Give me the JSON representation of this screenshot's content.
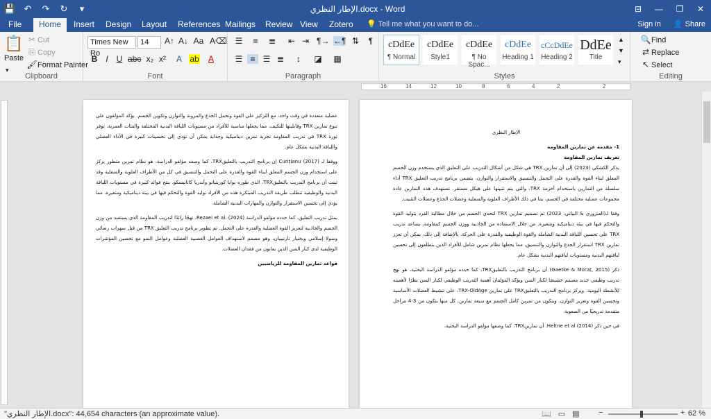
{
  "title": "الإطار النظري.docx - Word",
  "quick_access": {
    "save": "💾",
    "undo": "↶",
    "redo": "↷",
    "refresh": "↻",
    "customize": "▾"
  },
  "window_controls": {
    "ribbon_options": "⊟",
    "minimize": "—",
    "restore": "❐",
    "close": "✕"
  },
  "tabs": [
    "File",
    "Home",
    "Insert",
    "Design",
    "Layout",
    "References",
    "Mailings",
    "Review",
    "View",
    "Zotero"
  ],
  "tell_me": "Tell me what you want to do...",
  "sign_in": "Sign in",
  "share": "Share",
  "clipboard": {
    "label": "Clipboard",
    "paste": "Paste",
    "cut": "Cut",
    "copy": "Copy",
    "format_painter": "Format Painter"
  },
  "font": {
    "label": "Font",
    "family": "Times New Ro",
    "size": "14"
  },
  "paragraph": {
    "label": "Paragraph"
  },
  "styles": {
    "label": "Styles",
    "items": [
      {
        "sample": "cDdEe",
        "name": "¶ Normal"
      },
      {
        "sample": "cDdEe",
        "name": "Style1"
      },
      {
        "sample": "cDdEe",
        "name": "¶ No Spac..."
      },
      {
        "sample": "cDdEe",
        "name": "Heading 1"
      },
      {
        "sample": "cCcDdEe",
        "name": "Heading 2"
      },
      {
        "sample": "DdEe",
        "name": "Title"
      }
    ]
  },
  "editing": {
    "label": "Editing",
    "find": "Find",
    "replace": "Replace",
    "select": "Select"
  },
  "ruler_numbers": [
    "16",
    "14",
    "12",
    "10",
    "8",
    "6",
    "4",
    "2",
    "2"
  ],
  "right_page": {
    "title": "الإطار النظري",
    "heading1": "1- مقدمة عن تمارين المقاومة",
    "heading2": "تعريف تمارين المقاومة",
    "paragraphs": [
      "يذكر الكشكي (2023) إلى أن تمارين TRX هي شكل من أشكال التدريب على التعليق الذي يستخدم وزن الجسم المعلق لبناء القوة والقدرة على التحمل والتنسيق والاستقرار والتوازن. يتضمن برنامج تدريب التعليق TRX أداء سلسلة من التمارين باستخدام أحزمة TRX، والتي يتم تثبيتها على هيكل مستقر. تستهدف هذه التمارين عادة مجموعات عضلية مختلفة في الجسم، بما في ذلك الأطراف العلوية والسفلية وعضلات الجذع وعضلات التثبيت.",
      "وفقا لـ(العنزوري & البياتي، 2023) تم تصميم تمارين TRX لتحدي الجسم من خلال مطالبة الفرد بتوليد القوة والتحكم فيها في بيئة ديناميكية ومتغيرة. من خلال الاستفادة من الجاذبية ووزن الجسم كمقاومة، يساعد تدريب TRX على تحسين اللياقة البدنية الشاملة والقوة الوظيفية والقدرة على الحركة. بالإضافة إلى ذلك، يمكن أن تعزز تمارين TRX استقرار الجذع والتوازن والتنسيق، مما يجعلها نظام تمرين شامل للأفراد الذين يتطلعون إلى تحسين لياقتهم البدنية ومستويات لياقتهم البدنية بشكل عام.",
      "ذكر (Gaetke & Morat, 2015) أن برنامج التدريب بالتعليقTRX، كما حدده مؤلفو الدراسة البحثية، هو نهج تدريب وظيفي جديد مصمم خصيصًا لكبار السن ويؤكد المؤلفان أهمية التدريب الوظيفي لكبار السن نظرًا لأهميته للأنشطة اليومية. ويركز برنامج التدريب بالتعليقTRX على تمارين TRX-OldAge، على تنشيط العضلات الأساسية وتحسين القوة وتعزيز التوازن. ويتكون من تمرين كامل الجسم مع سبعة تمارين، كل منها يتكون من 3-4 مراحل متقدمة تدريجيًا من الصعوبة.",
      "في حين ذكر (2014) Heltne et al. أن تمارينTRX، كما وصفها مؤلفو الدراسة البحثية،"
    ]
  },
  "left_page": {
    "paragraphs": [
      "عضلية متعددة في وقت واحد، مع التركيز على القوة وتحمل الجذع والمرونة والتوازن وتكوين الجسم. يؤكد المؤلفون على تنوع تمارين TRX وقابليتها للتكيف، مما يجعلها مناسبة للأفراد من مستويات اللياقة البدنية المختلفة والفئات العمرية. توفر ثورة TRX في تدريب المقاومة تجربة تمرين ديناميكية وجذابة يمكن أن تؤدي إلى تحسينات كبيرة في الأداء العضلي واللياقة البدنية بشكل عام.",
      "ووفقا لـ Curițianu (2017) إن برنامج التدريب بالتعليقTRX، كما وصفه مؤلفو الدراسة، هو نظام تمرين متطور يركز على استخدام وزن الجسم المعلق لبناء القوة والقدرة على التحمل والتنسيق في كل من الأطراف العلوية والسفلية وقد ثبتت أن برنامج التدريب بالتعليقTRX، الذي طوره بوابا كوريتيانو وأندريا كاتانيسكو، ينتج فوائد كبيرة في مستويات اللياقة البدنية والوظيفية تتطلب طريقة التدريب المبتكرة هذه من الأفراد توليد القوة والتحكم فيها في بيئة ديناميكية ومتغيرة، مما يؤدي إلى تحسين الاستقرار والتوازن والمهارات البدنية الشاملة.",
      "يمثل تدريب التعليق، كما حدده مؤلفو الدراسة Rezaei et al. (2024)، نهجًا رائدًا لتدريب المقاومة الذي يستفيد من وزن الجسم والجاذبية لتعزيز القوة العضلية والقدرة على التحمل. تم تطوير برنامج تدريب التعليق TRX من قبل سهراب رضائي وسولا إسلامي وبختيار تارتيبيان، وهو مصمم لاستهداف العوامل العصبية العضلية وعوامل النمو مع تحسين المؤشرات الوظيفية لدى كبار السن الذين يعانون من فقدان العضلات.",
      "قواعد تمارين المقاومة للرياضيين"
    ]
  },
  "status": {
    "text": "\"الإطار النظري.docx\": 44,654 characters (an approximate value).",
    "zoom": "62 %"
  }
}
